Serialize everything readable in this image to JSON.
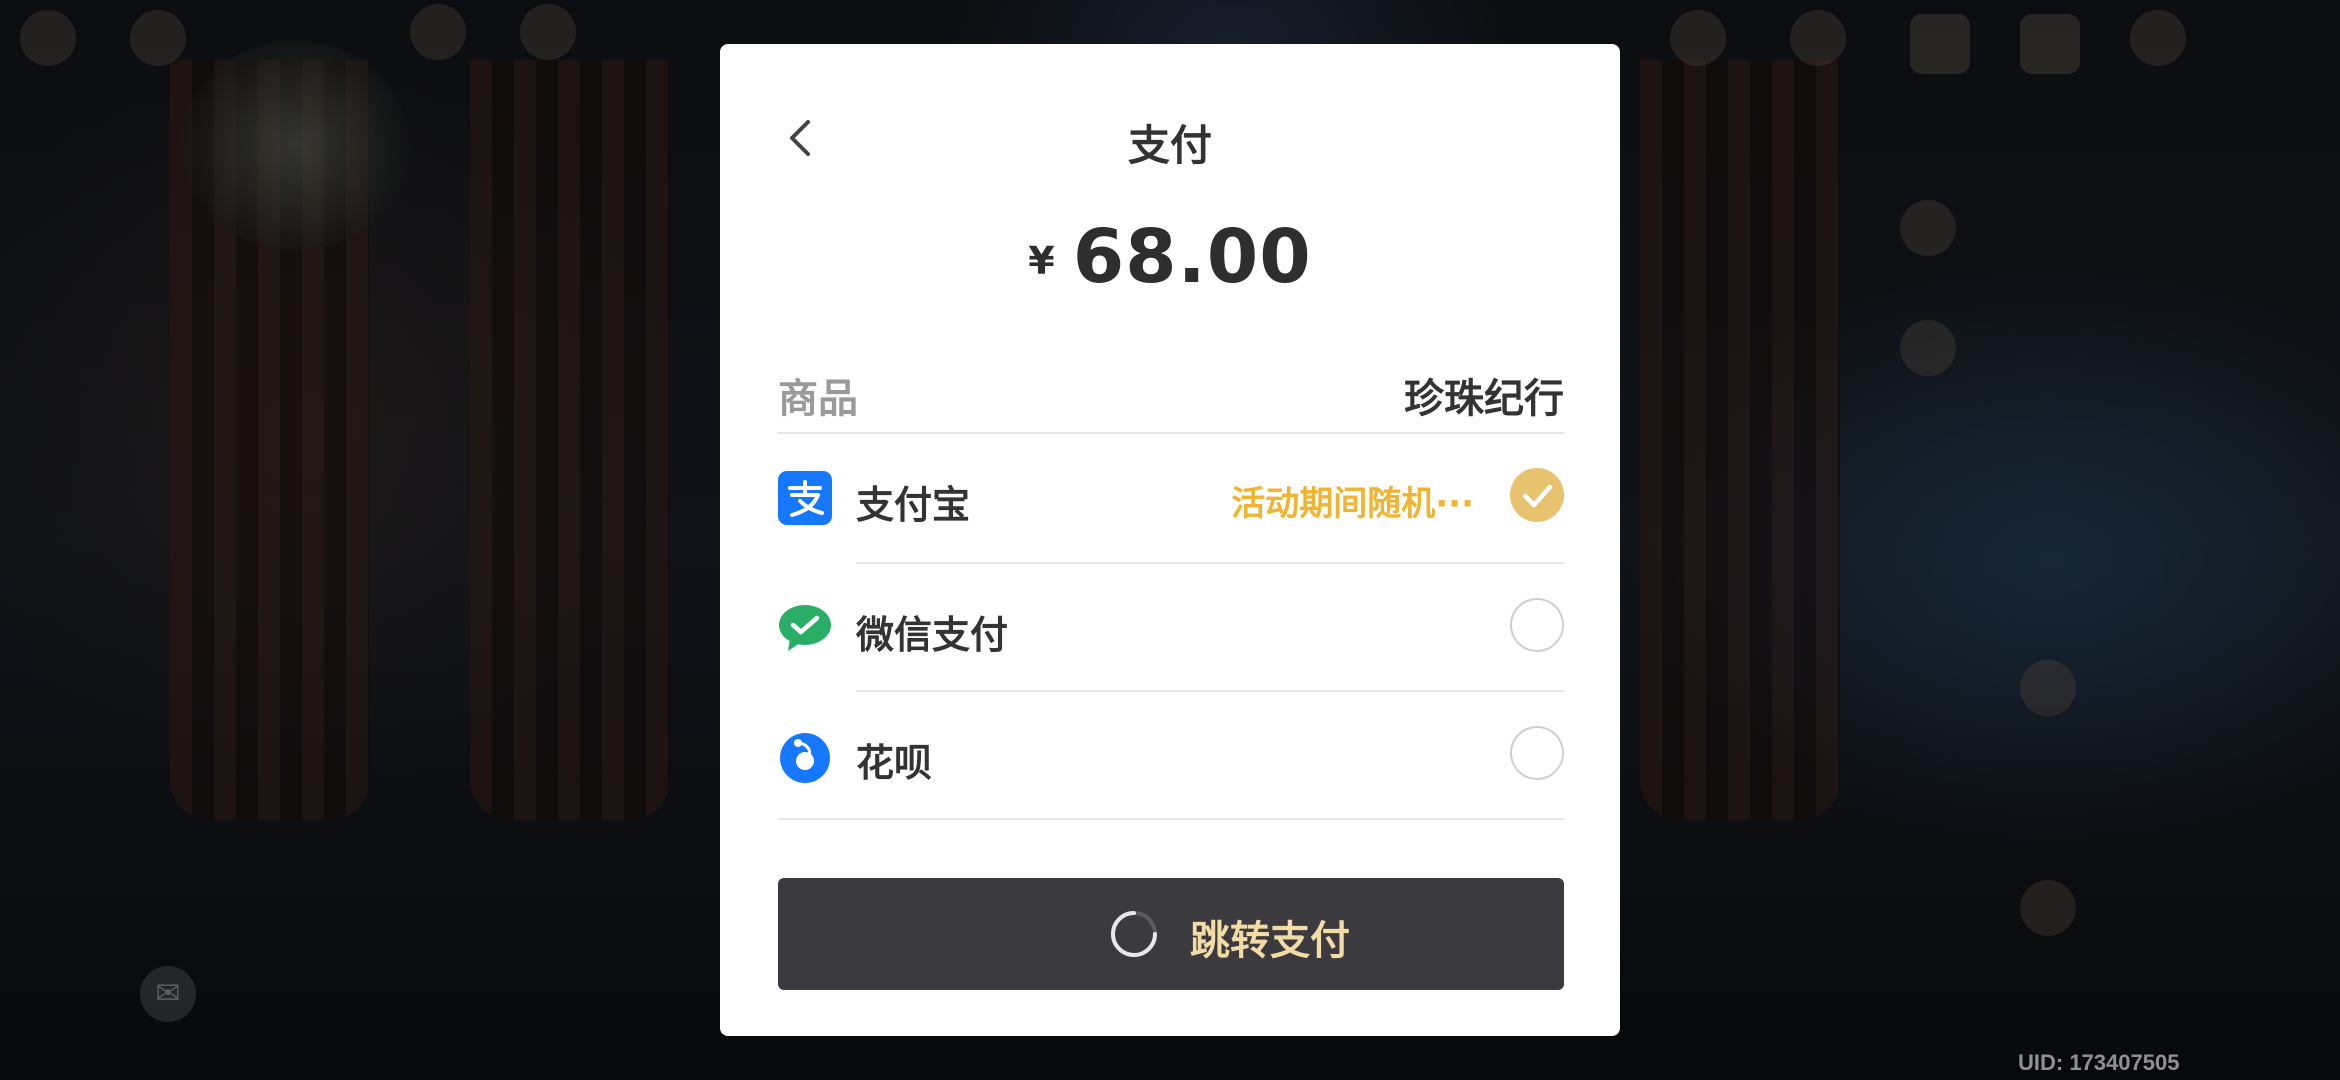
{
  "background": {
    "uid_text": "UID: 173407505"
  },
  "dialog": {
    "title": "支付",
    "currency_symbol": "¥",
    "amount": "68.00",
    "product_label": "商品",
    "product_value": "珍珠纪行",
    "methods": [
      {
        "label": "支付宝",
        "icon": "alipay-icon",
        "promo": "活动期间随机···",
        "selected": true,
        "color": "#1677ff"
      },
      {
        "label": "微信支付",
        "icon": "wechat-pay-icon",
        "promo": "",
        "selected": false,
        "color": "#2aae67"
      },
      {
        "label": "花呗",
        "icon": "huabei-icon",
        "promo": "",
        "selected": false,
        "color": "#1677ff"
      }
    ],
    "pay_button_label": "跳转支付",
    "colors": {
      "accent_gold": "#e7c26f",
      "promo_orange": "#f2b330",
      "button_dark": "#3a3a3f",
      "button_text": "#f3dba5"
    }
  }
}
